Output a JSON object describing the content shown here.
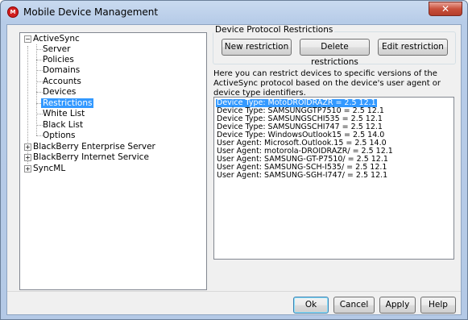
{
  "window": {
    "title": "Mobile Device Management",
    "close_symbol": "✕",
    "app_icon_text": "M"
  },
  "tree": {
    "items": [
      {
        "label": "ActiveSync",
        "expander": "−"
      },
      {
        "label": "Server"
      },
      {
        "label": "Policies"
      },
      {
        "label": "Domains"
      },
      {
        "label": "Accounts"
      },
      {
        "label": "Devices"
      },
      {
        "label": "Restrictions"
      },
      {
        "label": "White List"
      },
      {
        "label": "Black List"
      },
      {
        "label": "Options"
      },
      {
        "label": "BlackBerry Enterprise Server",
        "expander": "+"
      },
      {
        "label": "BlackBerry Internet Service",
        "expander": "+"
      },
      {
        "label": "SyncML",
        "expander": "+"
      }
    ]
  },
  "restrictions": {
    "group_title": "Device Protocol Restrictions",
    "new_label": "New restriction",
    "delete_label": "Delete restrictions",
    "edit_label": "Edit restriction",
    "description": "Here you can restrict devices to specific versions of the ActiveSync protocol based on the device's user agent or device type identifiers.",
    "list": [
      "Device Type: MotoDROIDRAZR = 2.5 12.1",
      "Device Type: SAMSUNGGTP7510 = 2.5 12.1",
      "Device Type: SAMSUNGSCHI535 = 2.5 12.1",
      "Device Type: SAMSUNGSCHI747 = 2.5 12.1",
      "Device Type: WindowsOutlook15 = 2.5 14.0",
      "User Agent: Microsoft.Outlook.15 = 2.5 14.0",
      "User Agent: motorola-DROIDRAZR/ = 2.5 12.1",
      "User Agent: SAMSUNG-GT-P7510/ = 2.5 12.1",
      "User Agent: SAMSUNG-SCH-I535/ = 2.5 12.1",
      "User Agent: SAMSUNG-SGH-I747/ = 2.5 12.1"
    ]
  },
  "footer": {
    "ok_label": "Ok",
    "cancel_label": "Cancel",
    "apply_label": "Apply",
    "help_label": "Help"
  },
  "colors": {
    "selection": "#3399ff",
    "titlebar": "#b9cde8",
    "close_button": "#c9503c"
  }
}
